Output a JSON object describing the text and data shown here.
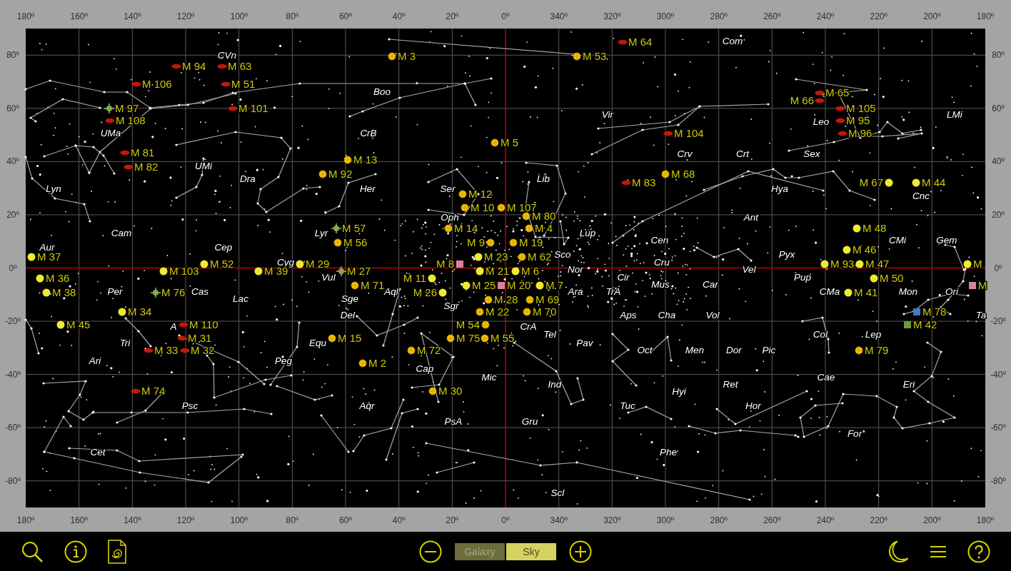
{
  "axes": {
    "top": [
      "180º",
      "160º",
      "140º",
      "120º",
      "100º",
      "80º",
      "60º",
      "40º",
      "20º",
      "0º",
      "340º",
      "320º",
      "300º",
      "280º",
      "260º",
      "240º",
      "220º",
      "200º",
      "180º"
    ],
    "bottom": [
      "180º",
      "160º",
      "140º",
      "120º",
      "100º",
      "80º",
      "60º",
      "40º",
      "20º",
      "0º",
      "340º",
      "320º",
      "300º",
      "280º",
      "260º",
      "240º",
      "220º",
      "200º",
      "180º"
    ],
    "left": [
      "80º",
      "60º",
      "40º",
      "20º",
      "0º",
      "-20º",
      "-40º",
      "-60º",
      "-80º"
    ],
    "right": [
      "80º",
      "60º",
      "40º",
      "20º",
      "0º",
      "-20º",
      "-40º",
      "-60º",
      "-80º"
    ]
  },
  "constellations": [
    "Com",
    "CVn",
    "Boo",
    "Vir",
    "LMi",
    "Leo",
    "UMa",
    "CrB",
    "Crv",
    "Crt",
    "Sex",
    "UMi",
    "Dra",
    "Lib",
    "Lyn",
    "Her",
    "Ser",
    "Hya",
    "Cnc",
    "Oph",
    "Ant",
    "Cam",
    "Lyr",
    "Lup",
    "Cen",
    "CMi",
    "Gem",
    "Aur",
    "Cep",
    "Sco",
    "Pyx",
    "Cyg",
    "Cru",
    "Nor",
    "Vel",
    "Vul",
    "Cir",
    "Pup",
    "Mus",
    "Car",
    "Per",
    "Cas",
    "Aql",
    "Ara",
    "TrA",
    "CMa",
    "Mon",
    "Ori",
    "Lac",
    "Sge",
    "Sgr",
    "Del",
    "Aps",
    "Cha",
    "Vol",
    "Ta",
    "A",
    "CrA",
    "Tel",
    "Col",
    "Lep",
    "Tri",
    "Equ",
    "Pav",
    "Oct",
    "Men",
    "Dor",
    "Pic",
    "Ari",
    "Peg",
    "Cap",
    "Mic",
    "Cae",
    "Ind",
    "Ret",
    "Eri",
    "Hyi",
    "Psc",
    "Aqr",
    "Tuc",
    "Hor",
    "PsA",
    "Gru",
    "For",
    "Cet",
    "Phe",
    "Scl"
  ],
  "objects": [
    {
      "label": "M 64",
      "kind": "galaxy"
    },
    {
      "label": "M 3",
      "kind": "globular"
    },
    {
      "label": "M 53",
      "kind": "globular"
    },
    {
      "label": "M 94",
      "kind": "galaxy"
    },
    {
      "label": "M 63",
      "kind": "galaxy"
    },
    {
      "label": "M 106",
      "kind": "galaxy"
    },
    {
      "label": "M 51",
      "kind": "galaxy"
    },
    {
      "label": "M 65",
      "kind": "galaxy"
    },
    {
      "label": "M 66",
      "kind": "galaxy"
    },
    {
      "label": "M 97",
      "kind": "planetary"
    },
    {
      "label": "M 101",
      "kind": "galaxy"
    },
    {
      "label": "M 105",
      "kind": "galaxy"
    },
    {
      "label": "M 108",
      "kind": "galaxy"
    },
    {
      "label": "M 95",
      "kind": "galaxy"
    },
    {
      "label": "M 104",
      "kind": "galaxy"
    },
    {
      "label": "M 96",
      "kind": "galaxy"
    },
    {
      "label": "M 5",
      "kind": "globular"
    },
    {
      "label": "M 81",
      "kind": "galaxy"
    },
    {
      "label": "M 13",
      "kind": "globular"
    },
    {
      "label": "M 82",
      "kind": "galaxy"
    },
    {
      "label": "M 92",
      "kind": "globular"
    },
    {
      "label": "M 68",
      "kind": "globular"
    },
    {
      "label": "M 83",
      "kind": "galaxy"
    },
    {
      "label": "M 67",
      "kind": "open"
    },
    {
      "label": "M 44",
      "kind": "open"
    },
    {
      "label": "M 12",
      "kind": "globular"
    },
    {
      "label": "M 10",
      "kind": "globular"
    },
    {
      "label": "M 107",
      "kind": "globular"
    },
    {
      "label": "M 80",
      "kind": "globular"
    },
    {
      "label": "M 57",
      "kind": "planetary"
    },
    {
      "label": "M 14",
      "kind": "globular"
    },
    {
      "label": "M 4",
      "kind": "globular"
    },
    {
      "label": "M 48",
      "kind": "open"
    },
    {
      "label": "M 56",
      "kind": "globular"
    },
    {
      "label": "M 9",
      "kind": "globular"
    },
    {
      "label": "M 19",
      "kind": "globular"
    },
    {
      "label": "M 46",
      "kind": "open"
    },
    {
      "label": "M 37",
      "kind": "open"
    },
    {
      "label": "M 23",
      "kind": "open"
    },
    {
      "label": "M 62",
      "kind": "globular"
    },
    {
      "label": "M 52",
      "kind": "open"
    },
    {
      "label": "M 29",
      "kind": "open"
    },
    {
      "label": "M 8",
      "kind": "nebula",
      "color": "#d9829a"
    },
    {
      "label": "M 93",
      "kind": "open"
    },
    {
      "label": "M 47",
      "kind": "open"
    },
    {
      "label": "M",
      "kind": "open"
    },
    {
      "label": "M 103",
      "kind": "open"
    },
    {
      "label": "M 39",
      "kind": "open"
    },
    {
      "label": "M 27",
      "kind": "planetary"
    },
    {
      "label": "M 21",
      "kind": "open"
    },
    {
      "label": "M 6",
      "kind": "open"
    },
    {
      "label": "M 36",
      "kind": "open"
    },
    {
      "label": "M 11",
      "kind": "open"
    },
    {
      "label": "M 50",
      "kind": "open"
    },
    {
      "label": "M 71",
      "kind": "globular"
    },
    {
      "label": "M 25",
      "kind": "open"
    },
    {
      "label": "M 20",
      "kind": "nebula",
      "color": "#d9829a"
    },
    {
      "label": "M 7",
      "kind": "open"
    },
    {
      "label": "M",
      "kind": "nebula",
      "color": "#d9829a"
    },
    {
      "label": "M 38",
      "kind": "open"
    },
    {
      "label": "M 76",
      "kind": "planetary"
    },
    {
      "label": "M 26",
      "kind": "open"
    },
    {
      "label": "M 41",
      "kind": "open"
    },
    {
      "label": "M 28",
      "kind": "globular"
    },
    {
      "label": "M 69",
      "kind": "globular"
    },
    {
      "label": "M 34",
      "kind": "open"
    },
    {
      "label": "M 22",
      "kind": "globular"
    },
    {
      "label": "M 70",
      "kind": "globular"
    },
    {
      "label": "M 78",
      "kind": "nebula",
      "color": "#3d7cc9"
    },
    {
      "label": "M 45",
      "kind": "open"
    },
    {
      "label": "M 110",
      "kind": "galaxy"
    },
    {
      "label": "M 54",
      "kind": "globular"
    },
    {
      "label": "M 42",
      "kind": "nebula",
      "color": "#6e9a3c"
    },
    {
      "label": "M 31",
      "kind": "galaxy"
    },
    {
      "label": "M 15",
      "kind": "globular"
    },
    {
      "label": "M 75",
      "kind": "globular"
    },
    {
      "label": "M 55",
      "kind": "globular"
    },
    {
      "label": "M 33",
      "kind": "galaxy"
    },
    {
      "label": "M 32",
      "kind": "galaxy"
    },
    {
      "label": "M 72",
      "kind": "globular"
    },
    {
      "label": "M 79",
      "kind": "globular"
    },
    {
      "label": "M 2",
      "kind": "globular"
    },
    {
      "label": "M 74",
      "kind": "galaxy"
    },
    {
      "label": "M 30",
      "kind": "globular"
    }
  ],
  "toolbar": {
    "view_tabs": [
      {
        "label": "Galaxy",
        "selected": false
      },
      {
        "label": "Sky",
        "selected": true
      }
    ]
  }
}
